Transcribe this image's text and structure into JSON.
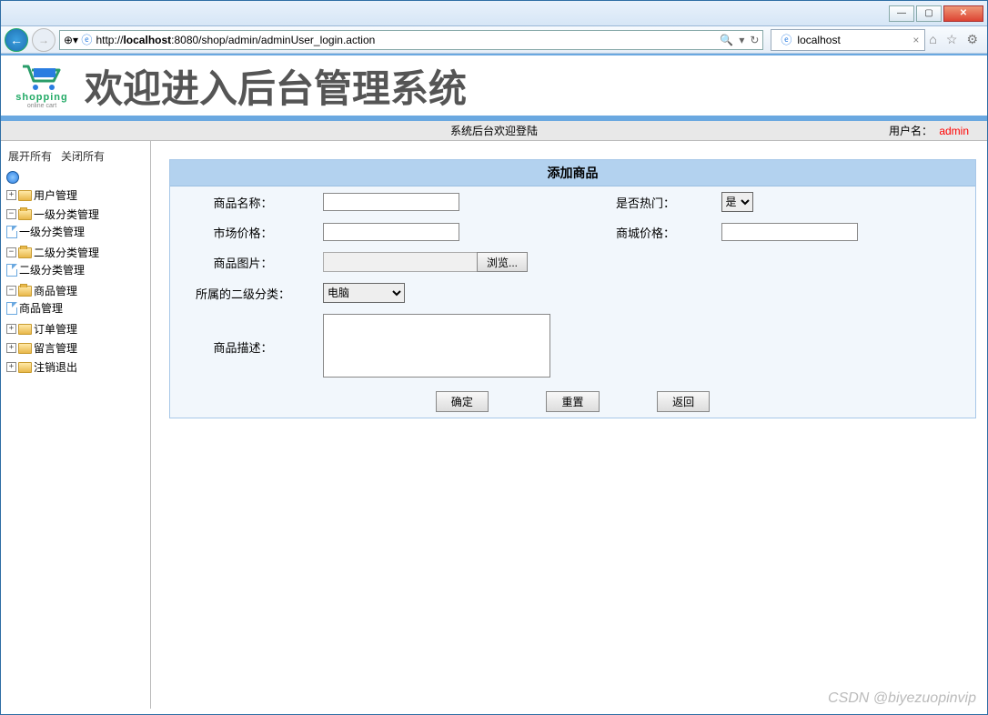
{
  "browser": {
    "url_display": "http://localhost:8080/shop/admin/adminUser_login.action",
    "host": "localhost",
    "tab_title": "localhost"
  },
  "banner": {
    "logo_text": "shopping",
    "logo_sub": "online cart",
    "title": "欢迎进入后台管理系统"
  },
  "statusbar": {
    "center": "系统后台欢迎登陆",
    "user_label": "用户名：",
    "user_name": "admin"
  },
  "sidebar": {
    "expand_all": "展开所有",
    "collapse_all": "关闭所有",
    "nodes": {
      "user_mgmt": "用户管理",
      "cat1_mgmt": "一级分类管理",
      "cat1_child": "一级分类管理",
      "cat2_mgmt": "二级分类管理",
      "cat2_child": "二级分类管理",
      "product_mgmt": "商品管理",
      "product_child": "商品管理",
      "order_mgmt": "订单管理",
      "msg_mgmt": "留言管理",
      "logout": "注销退出"
    }
  },
  "form": {
    "title": "添加商品",
    "labels": {
      "name": "商品名称：",
      "hot": "是否热门：",
      "market_price": "市场价格：",
      "mall_price": "商城价格：",
      "image": "商品图片：",
      "browse": "浏览...",
      "category": "所属的二级分类：",
      "desc": "商品描述："
    },
    "hot_options": [
      "是"
    ],
    "hot_value": "是",
    "category_options": [
      "电脑"
    ],
    "category_value": "电脑",
    "buttons": {
      "ok": "确定",
      "reset": "重置",
      "back": "返回"
    }
  },
  "watermark": "CSDN @biyezuopinvip"
}
